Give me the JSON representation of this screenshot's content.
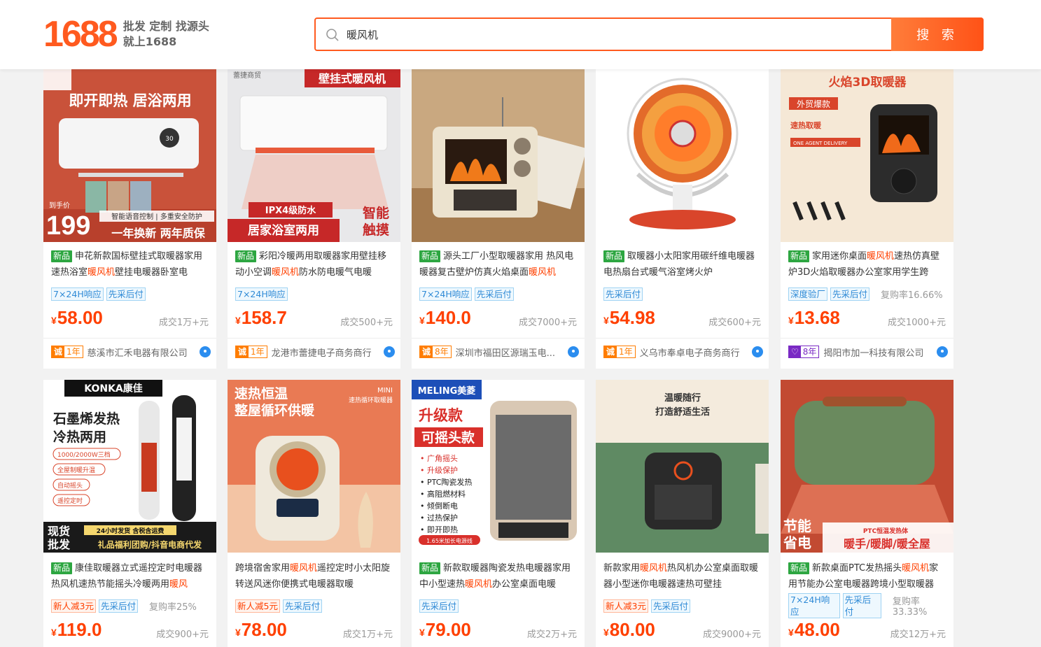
{
  "header": {
    "logo_number": "1688",
    "logo_line1": "批发 定制 找源头",
    "logo_line2": "就上1688",
    "search_value": "暖风机",
    "search_button": "搜 索"
  },
  "products": [
    {
      "new": "新品",
      "title_pre": "申花新款国标壁挂式取暖器家用速热浴室",
      "title_hl": "暖风机",
      "title_post": "壁挂电暖器卧室电",
      "tags": [
        "7×24H响应",
        "先采后付"
      ],
      "tag_plain": "",
      "currency": "¥",
      "price": "58.00",
      "sold": "成交1万+元",
      "cheng_a": "诚",
      "cheng_years": "1年",
      "seller": "慈溪市汇禾电器有限公司",
      "purple": false
    },
    {
      "new": "新品",
      "title_pre": "彩阳冷暖两用取暖器家用壁挂移动小空调",
      "title_hl": "暖风机",
      "title_post": "防水防电暖气电暖",
      "tags": [
        "7×24H响应"
      ],
      "tag_plain": "",
      "currency": "¥",
      "price": "158.7",
      "sold": "成交500+元",
      "cheng_a": "诚",
      "cheng_years": "1年",
      "seller": "龙港市蕾捷电子商务商行",
      "purple": false
    },
    {
      "new": "新品",
      "title_pre": "源头工厂小型取暖器家用 热风电暖器复古壁炉仿真火焰桌面",
      "title_hl": "暖风机",
      "title_post": "",
      "tags": [
        "7×24H响应",
        "先采后付"
      ],
      "tag_plain": "",
      "currency": "¥",
      "price": "140.0",
      "sold": "成交7000+元",
      "cheng_a": "诚",
      "cheng_years": "8年",
      "seller": "深圳市福田区源瑞玉电...",
      "purple": false
    },
    {
      "new": "新品",
      "title_pre": "取暖器小太阳家用碳纤维电暖器电热扇台式暖气浴室烤火炉",
      "title_hl": "",
      "title_post": "",
      "tags": [
        "先采后付"
      ],
      "tag_plain": "",
      "currency": "¥",
      "price": "54.98",
      "sold": "成交600+元",
      "cheng_a": "诚",
      "cheng_years": "1年",
      "seller": "义乌市奉卓电子商务商行",
      "purple": false
    },
    {
      "new": "新品",
      "title_pre": "家用迷你桌面",
      "title_hl": "暖风机",
      "title_post": "速热仿真壁炉3D火焰取暖器办公室家用学生跨",
      "tags": [
        "深度验厂",
        "先采后付"
      ],
      "tag_plain": "复购率16.66%",
      "currency": "¥",
      "price": "13.68",
      "sold": "成交1000+元",
      "cheng_a": "♡",
      "cheng_years": "8年",
      "seller": "揭阳市加一科技有限公司",
      "purple": true
    },
    {
      "new": "新品",
      "title_pre": "康佳取暖器立式遥控定时电暖器热风机速热节能摇头冷暖两用",
      "title_hl": "暖风",
      "title_post": "",
      "tags_red": [
        "新人减3元"
      ],
      "tags": [
        "先采后付"
      ],
      "tag_plain": "复购率25%",
      "currency": "¥",
      "price": "119.0",
      "sold": "成交900+元"
    },
    {
      "new": "",
      "title_pre": "跨境宿舍家用",
      "title_hl": "暖风机",
      "title_post": "遥控定时小太阳旋转送风迷你便携式电暖器取暖",
      "tags_red": [
        "新人减5元"
      ],
      "tags": [
        "先采后付"
      ],
      "tag_plain": "",
      "currency": "¥",
      "price": "78.00",
      "sold": "成交1万+元"
    },
    {
      "new": "新品",
      "title_pre": "新款取暖器陶瓷发热电暖器家用中小型速热",
      "title_hl": "暖风机",
      "title_post": "办公室桌面电暖",
      "tags_red": [],
      "tags": [
        "先采后付"
      ],
      "tag_plain": "",
      "currency": "¥",
      "price": "79.00",
      "sold": "成交2万+元"
    },
    {
      "new": "",
      "title_pre": "新款家用",
      "title_hl": "暖风机",
      "title_post": "热风机办公室桌面取暖器小型迷你电暖器速热可壁挂",
      "tags_red": [
        "新人减3元"
      ],
      "tags": [
        "先采后付"
      ],
      "tag_plain": "",
      "currency": "¥",
      "price": "80.00",
      "sold": "成交9000+元"
    },
    {
      "new": "新品",
      "title_pre": "新款桌面PTC发热摇头",
      "title_hl": "暖风机",
      "title_post": "家用节能办公室电暖器跨境小型取暖器",
      "tags_red": [],
      "tags": [
        "7×24H响应",
        "先采后付"
      ],
      "tag_plain": "复购率33.33%",
      "currency": "¥",
      "price": "48.00",
      "sold": "成交12万+元"
    }
  ],
  "image_text": {
    "p0_l1": "即开即热 居浴两用",
    "p0_l2": "199",
    "p0_l3": "一年换新 两年质保",
    "p0_l4": "智能语音控制 | 多重安全防护",
    "p0_l5": "到手价",
    "p1_l1": "壁挂式暖风机",
    "p1_l2": "IPX4级防水",
    "p1_l3": "居家浴室两用",
    "p1_l4": "智能",
    "p1_l5": "触摸",
    "p1_l6": "蕾捷商贸",
    "p4_l1": "火焰3D取暖器",
    "p4_l2": "外贸爆款",
    "p4_l3": "速热取暖",
    "p4_l4": "ONE AGENT DELIVERY",
    "p5_l1": "KONKA康佳",
    "p5_l2": "石墨烯发热",
    "p5_l3": "冷热两用",
    "p5_l4": "1000/2000W三档",
    "p5_l5": "全屋制暖升温",
    "p5_l6": "自动摇头",
    "p5_l7": "遥控定时",
    "p5_l8": "现货",
    "p5_l9": "批发",
    "p5_l10": "24小时发货 含税含运费",
    "p5_l11": "礼品福利团购/抖音电商代发",
    "p6_l1": "速热恒温",
    "p6_l2": "整屋循环供暖",
    "p6_l3": "MINI",
    "p6_l4": "速热循环取暖器",
    "p7_l1": "MELING美菱",
    "p7_l2": "升级款",
    "p7_l3": "可摇头款",
    "p7_l4": "• 广角摇头",
    "p7_l5": "• 升级保护",
    "p7_l6": "• PTC陶瓷发热",
    "p7_l7": "• 高阻燃材料",
    "p7_l8": "• 倾倒断电",
    "p7_l9": "• 过热保护",
    "p7_l10": "• 即开即热",
    "p7_l11": "1.65米加长电源线",
    "p8_l1": "温暖随行",
    "p8_l2": "打造舒适生活",
    "p9_l1": "节能",
    "p9_l2": "省电",
    "p9_l3": "PTC恒温发热体",
    "p9_l4": "暖手/暖脚/暖全屋"
  }
}
